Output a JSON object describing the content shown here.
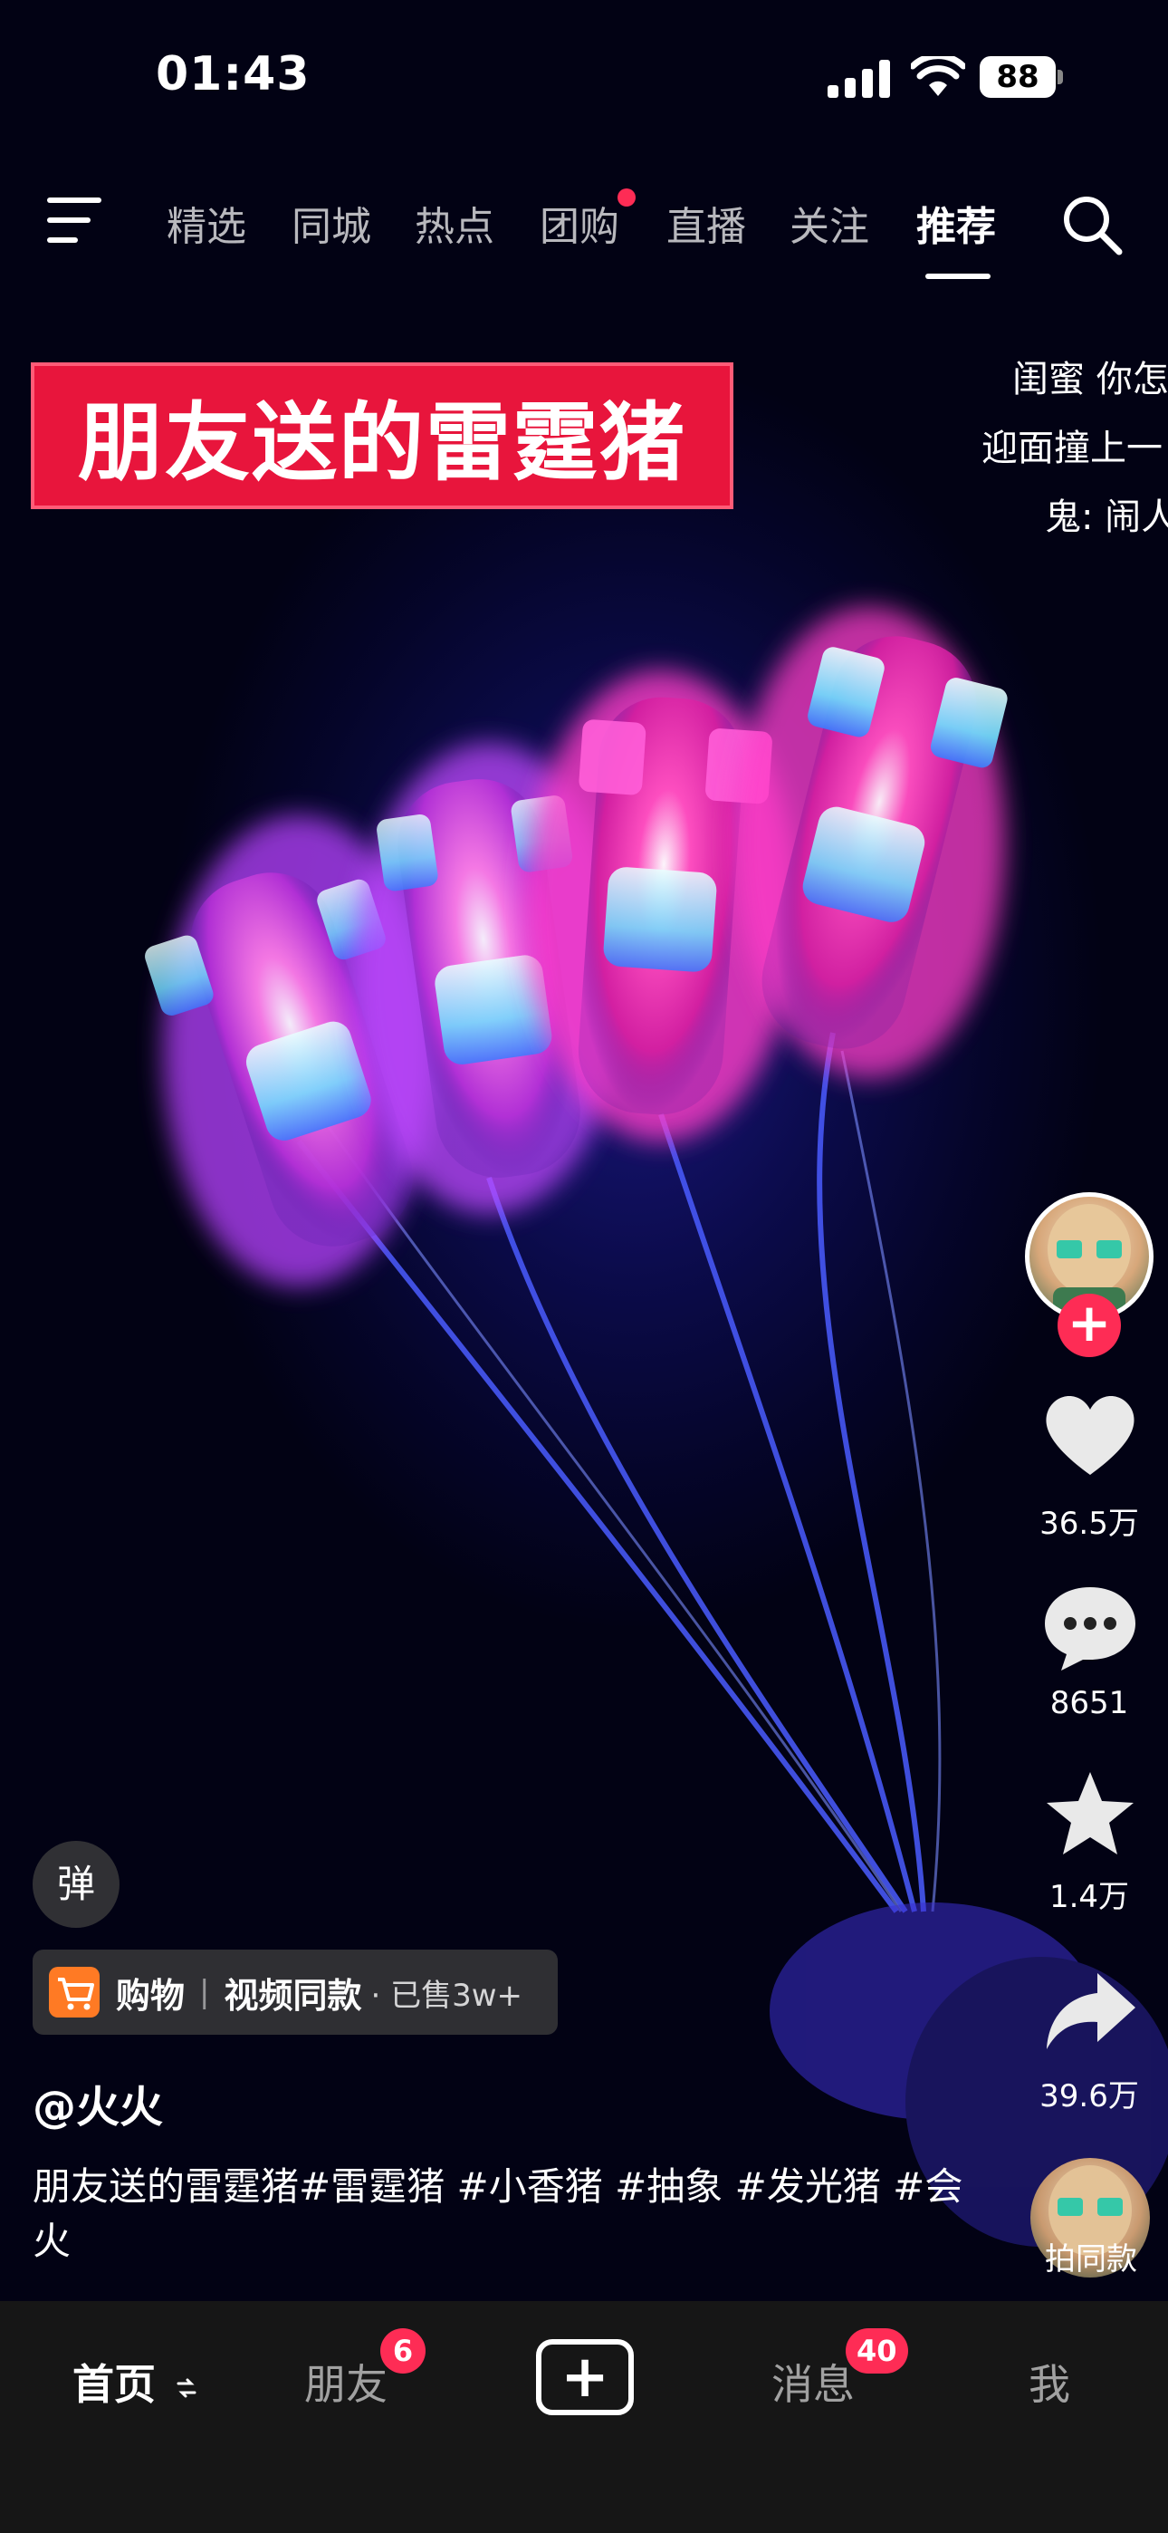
{
  "status_bar": {
    "time": "01:43",
    "battery": "88"
  },
  "top_nav": {
    "tabs": [
      {
        "label": "精选"
      },
      {
        "label": "同城"
      },
      {
        "label": "热点"
      },
      {
        "label": "团购"
      },
      {
        "label": "直播"
      },
      {
        "label": "关注"
      },
      {
        "label": "推荐"
      }
    ],
    "active_tab": "推荐"
  },
  "video": {
    "title_overlay": "朋友送的雷霆猪",
    "floating_comments": [
      "闺蜜  你怎",
      "迎面撞上一",
      "鬼: 闹人"
    ]
  },
  "right_rail": {
    "follow_symbol": "+",
    "likes": "36.5万",
    "comments": "8651",
    "favorites": "1.4万",
    "shares": "39.6万",
    "same_style_label": "拍同款"
  },
  "info": {
    "danmu_label": "弹",
    "shop": {
      "label": "购物",
      "separator": "|",
      "same": "视频同款",
      "sold": "· 已售3w+"
    },
    "username": "@火火",
    "caption": "朋友送的雷霆猪#雷霆猪 #小香猪 #抽象 #发光猪 #会火"
  },
  "tab_bar": {
    "home": "首页",
    "friends": "朋友",
    "friends_badge": "6",
    "create": "+",
    "messages": "消息",
    "messages_badge": "40",
    "me": "我"
  },
  "colors": {
    "accent": "#fe2c55",
    "banner": "#e8153c",
    "shop_icon": "#ff7a24"
  }
}
